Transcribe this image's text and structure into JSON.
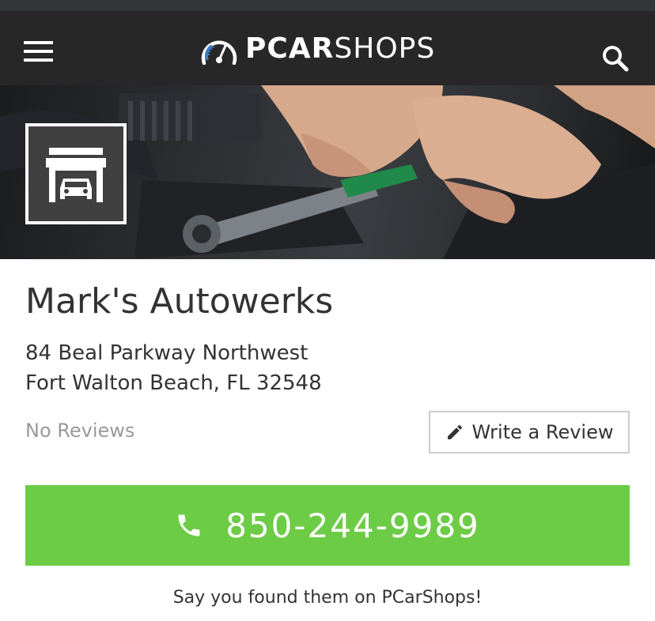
{
  "header": {
    "logo": {
      "bold": "PCAR",
      "light": "SHOPS"
    },
    "menu_icon": "hamburger-menu-icon",
    "search_icon": "search-icon",
    "background": "#272727"
  },
  "hero": {
    "image": "mechanic-hands-wrench-engine",
    "shop_icon": "garage-car-icon"
  },
  "shop": {
    "name": "Mark's Autowerks",
    "address_line1": "84 Beal Parkway Northwest",
    "address_line2": "Fort Walton Beach, FL 32548",
    "reviews": "No Reviews"
  },
  "actions": {
    "write_review_label": "Write a Review",
    "write_review_icon": "pencil-icon",
    "phone": "850-244-9989",
    "phone_icon": "phone-icon",
    "call_color": "#6dcc46"
  },
  "footer_note": "Say you found them on PCarShops!"
}
